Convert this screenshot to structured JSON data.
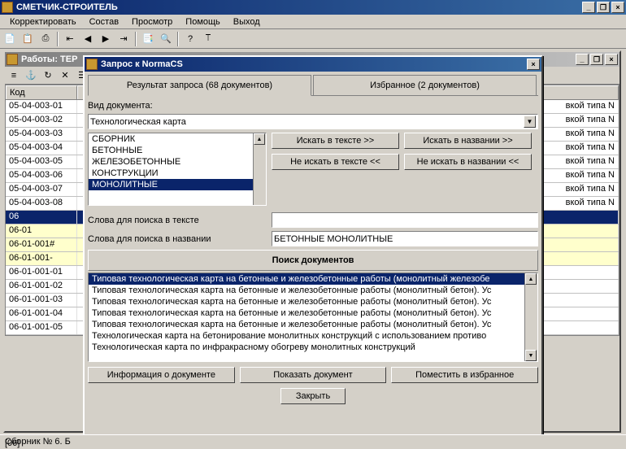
{
  "app": {
    "title": "СМЕТЧИК-СТРОИТЕЛЬ"
  },
  "menu": {
    "items": [
      "Корректировать",
      "Состав",
      "Просмотр",
      "Помощь",
      "Выход"
    ]
  },
  "outerWin": {
    "title": "Работы: ТЕР"
  },
  "grid": {
    "header": "Код",
    "rows": [
      {
        "code": "05-04-003-01",
        "desc": "вкой типа N"
      },
      {
        "code": "05-04-003-02",
        "desc": "вкой типа N"
      },
      {
        "code": "05-04-003-03",
        "desc": "вкой типа N"
      },
      {
        "code": "05-04-003-04",
        "desc": "вкой типа N"
      },
      {
        "code": "05-04-003-05",
        "desc": "вкой типа N"
      },
      {
        "code": "05-04-003-06",
        "desc": "вкой типа N"
      },
      {
        "code": "05-04-003-07",
        "desc": "вкой типа N"
      },
      {
        "code": "05-04-003-08",
        "desc": "вкой типа N"
      },
      {
        "code": "06",
        "desc": ""
      },
      {
        "code": "06-01",
        "desc": ""
      },
      {
        "code": "06-01-001#",
        "desc": ""
      },
      {
        "code": "06-01-001-",
        "desc": ""
      },
      {
        "code": "06-01-001-01",
        "desc": ""
      },
      {
        "code": "06-01-001-02",
        "desc": ""
      },
      {
        "code": "06-01-001-03",
        "desc": ""
      },
      {
        "code": "06-01-001-04",
        "desc": ""
      },
      {
        "code": "06-01-001-05",
        "desc": ""
      }
    ]
  },
  "dialog": {
    "title": "Запрос к NormaCS",
    "tabResult": "Результат запроса (68 документов)",
    "tabFav": "Избранное (2 документов)",
    "docTypeLabel": "Вид документа:",
    "docType": "Технологическая карта",
    "keywords": [
      "СБОРНИК",
      "БЕТОННЫЕ",
      "ЖЕЛЕЗОБЕТОННЫЕ",
      "КОНСТРУКЦИИ",
      "МОНОЛИТНЫЕ"
    ],
    "btnSearchText": "Искать в тексте >>",
    "btnSearchName": "Искать в названии >>",
    "btnNoSearchText": "Не искать в тексте <<",
    "btnNoSearchName": "Не искать в названии <<",
    "textSearchLabel": "Слова для поиска в тексте",
    "textSearchValue": "",
    "nameSearchLabel": "Слова для поиска в названии",
    "nameSearchValue": "БЕТОННЫЕ МОНОЛИТНЫЕ",
    "searchHeader": "Поиск документов",
    "results": [
      "Типовая технологическая карта на бетонные и железобетонные работы (монолитный железобе",
      "Типовая технологическая карта на бетонные и железобетонные работы (монолитный бетон). Ус",
      "Типовая технологическая карта на бетонные и железобетонные работы (монолитный бетон). Ус",
      "Типовая технологическая карта на бетонные и железобетонные работы (монолитный бетон). Ус",
      "Типовая технологическая карта на бетонные и железобетонные работы (монолитный бетон). Ус",
      "Технологическая карта на бетонирование монолитных конструкций с использованием противо",
      "Технологическая карта по инфракрасному обогреву монолитных конструкций"
    ],
    "btnInfo": "Информация о документе",
    "btnShow": "Показать документ",
    "btnFav": "Поместить в избранное",
    "btnClose": "Закрыть"
  },
  "status": {
    "left": "Сборник № 6. Б",
    "code": "[06]"
  }
}
